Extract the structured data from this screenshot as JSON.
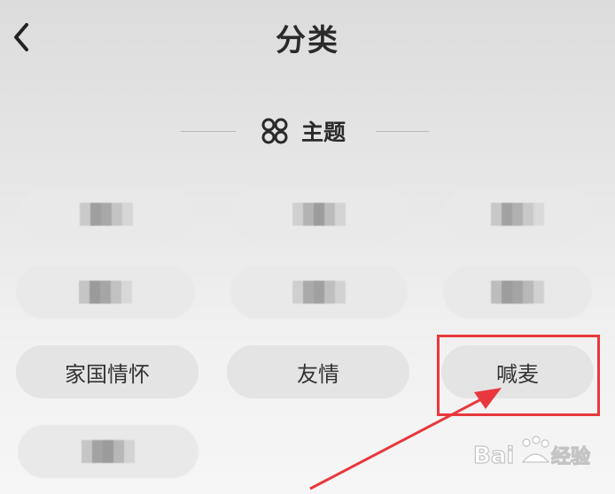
{
  "header": {
    "title": "分类",
    "back_icon": "chevron-left-icon"
  },
  "section": {
    "title": "主题",
    "icon": "grid-four-circles-icon"
  },
  "categories": [
    {
      "label": "",
      "blurred": true
    },
    {
      "label": "",
      "blurred": true
    },
    {
      "label": "",
      "blurred": true
    },
    {
      "label": "",
      "blurred": true
    },
    {
      "label": "",
      "blurred": true
    },
    {
      "label": "",
      "blurred": true
    },
    {
      "label": "家国情怀",
      "blurred": false
    },
    {
      "label": "友情",
      "blurred": false
    },
    {
      "label": "喊麦",
      "blurred": false,
      "highlighted": true
    },
    {
      "label": "",
      "blurred": true
    }
  ],
  "annotation": {
    "color": "#e8383d"
  },
  "watermark": {
    "text": "Baidu经验"
  }
}
